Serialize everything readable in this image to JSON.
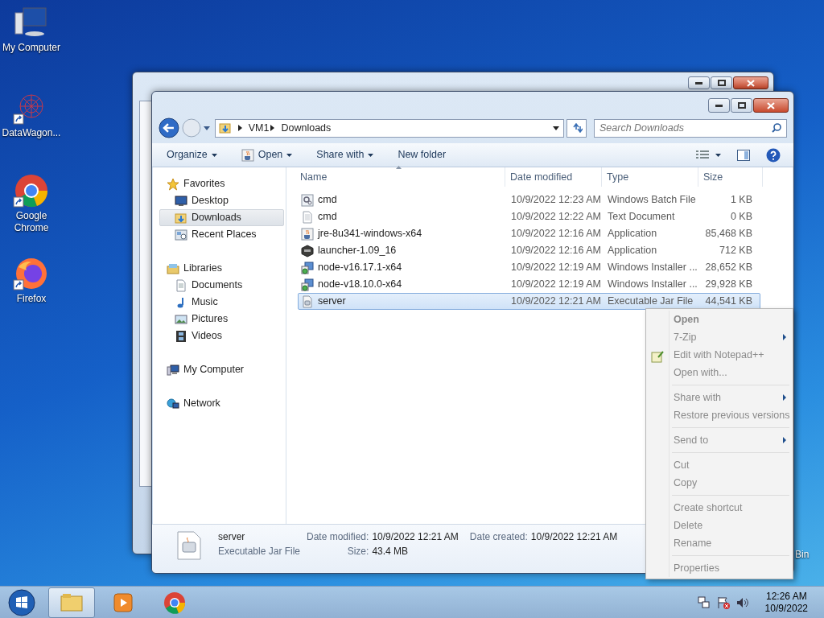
{
  "desktop_icons": [
    {
      "label": "My Computer",
      "kind": "computer",
      "shortcut": false
    },
    {
      "label": "DataWagon...",
      "kind": "network-art",
      "shortcut": true
    },
    {
      "label": "Google Chrome",
      "kind": "chrome",
      "shortcut": true
    },
    {
      "label": "Firefox",
      "kind": "firefox",
      "shortcut": true
    }
  ],
  "desktop_partial_label": "Bin",
  "explorer": {
    "address": [
      "VM1",
      "Downloads"
    ],
    "search": {
      "placeholder": "Search Downloads"
    },
    "toolbar": [
      {
        "label": "Organize",
        "kind": "plain",
        "dropdown": true
      },
      {
        "label": "Open",
        "kind": "java",
        "dropdown": true
      },
      {
        "label": "Share with",
        "kind": "plain",
        "dropdown": true
      },
      {
        "label": "New folder",
        "kind": "plain",
        "dropdown": false
      }
    ],
    "nav": [
      {
        "label": "Favorites",
        "kind": "star",
        "selected": false,
        "children": [
          {
            "label": "Desktop",
            "kind": "desktop",
            "selected": false
          },
          {
            "label": "Downloads",
            "kind": "downloads",
            "selected": true
          },
          {
            "label": "Recent Places",
            "kind": "recent",
            "selected": false
          }
        ]
      },
      {
        "label": "Libraries",
        "kind": "library",
        "selected": false,
        "children": [
          {
            "label": "Documents",
            "kind": "document",
            "selected": false
          },
          {
            "label": "Music",
            "kind": "music",
            "selected": false
          },
          {
            "label": "Pictures",
            "kind": "picture",
            "selected": false
          },
          {
            "label": "Videos",
            "kind": "video",
            "selected": false
          }
        ]
      },
      {
        "label": "My Computer",
        "kind": "computer",
        "selected": false
      },
      {
        "label": "Network",
        "kind": "network",
        "selected": false
      }
    ],
    "columns": [
      {
        "label": "Name",
        "sorted": true
      },
      {
        "label": "Date modified",
        "sorted": false
      },
      {
        "label": "Type",
        "sorted": false
      },
      {
        "label": "Size",
        "sorted": false
      }
    ],
    "rows": [
      {
        "name": "cmd",
        "kind": "batch",
        "date": "10/9/2022 12:23 AM",
        "type": "Windows Batch File",
        "size": "1 KB",
        "selected": false
      },
      {
        "name": "cmd",
        "kind": "text",
        "date": "10/9/2022 12:22 AM",
        "type": "Text Document",
        "size": "0 KB",
        "selected": false
      },
      {
        "name": "jre-8u341-windows-x64",
        "kind": "java",
        "date": "10/9/2022 12:16 AM",
        "type": "Application",
        "size": "85,468 KB",
        "selected": false
      },
      {
        "name": "launcher-1.09_16",
        "kind": "launcher",
        "date": "10/9/2022 12:16 AM",
        "type": "Application",
        "size": "712 KB",
        "selected": false
      },
      {
        "name": "node-v16.17.1-x64",
        "kind": "installer",
        "date": "10/9/2022 12:19 AM",
        "type": "Windows Installer ...",
        "size": "28,652 KB",
        "selected": false
      },
      {
        "name": "node-v18.10.0-x64",
        "kind": "installer",
        "date": "10/9/2022 12:19 AM",
        "type": "Windows Installer ...",
        "size": "29,928 KB",
        "selected": false
      },
      {
        "name": "server",
        "kind": "jar",
        "date": "10/9/2022 12:21 AM",
        "type": "Executable Jar File",
        "size": "44,541 KB",
        "selected": true
      }
    ],
    "details": {
      "name": "server",
      "type": "Executable Jar File",
      "fields": [
        {
          "label": "Date modified:",
          "value": "10/9/2022 12:21 AM"
        },
        {
          "label": "Size:",
          "value": "43.4 MB"
        },
        {
          "label": "Date created:",
          "value": "10/9/2022 12:21 AM"
        }
      ]
    }
  },
  "context_menu": [
    {
      "kind": "item",
      "label": "Open",
      "default": true,
      "submenu": false,
      "icon": false
    },
    {
      "kind": "item",
      "label": "7-Zip",
      "default": false,
      "submenu": true,
      "icon": false
    },
    {
      "kind": "item",
      "label": "Edit with Notepad++",
      "default": false,
      "submenu": false,
      "icon": true
    },
    {
      "kind": "item",
      "label": "Open with...",
      "default": false,
      "submenu": false,
      "icon": false
    },
    {
      "kind": "separator"
    },
    {
      "kind": "item",
      "label": "Share with",
      "default": false,
      "submenu": true,
      "icon": false
    },
    {
      "kind": "item",
      "label": "Restore previous versions",
      "default": false,
      "submenu": false,
      "icon": false
    },
    {
      "kind": "separator"
    },
    {
      "kind": "item",
      "label": "Send to",
      "default": false,
      "submenu": true,
      "icon": false
    },
    {
      "kind": "separator"
    },
    {
      "kind": "item",
      "label": "Cut",
      "default": false,
      "submenu": false,
      "icon": false
    },
    {
      "kind": "item",
      "label": "Copy",
      "default": false,
      "submenu": false,
      "icon": false
    },
    {
      "kind": "separator"
    },
    {
      "kind": "item",
      "label": "Create shortcut",
      "default": false,
      "submenu": false,
      "icon": false
    },
    {
      "kind": "item",
      "label": "Delete",
      "default": false,
      "submenu": false,
      "icon": false
    },
    {
      "kind": "item",
      "label": "Rename",
      "default": false,
      "submenu": false,
      "icon": false
    },
    {
      "kind": "separator"
    },
    {
      "kind": "item",
      "label": "Properties",
      "default": false,
      "submenu": false,
      "icon": false
    }
  ],
  "taskbar": {
    "items": [
      {
        "kind": "explorer",
        "active": true
      },
      {
        "kind": "media",
        "active": false
      },
      {
        "kind": "chrome",
        "active": false
      }
    ],
    "time": "12:26 AM",
    "date": "10/9/2022"
  }
}
